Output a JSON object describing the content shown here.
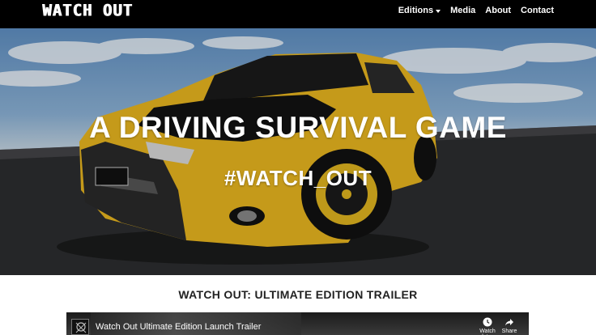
{
  "navbar": {
    "brand": "WATCH OUT",
    "links": [
      {
        "label": "Editions",
        "has_dropdown": true
      },
      {
        "label": "Media"
      },
      {
        "label": "About"
      },
      {
        "label": "Contact"
      }
    ]
  },
  "hero": {
    "title": "A DRIVING SURVIVAL GAME",
    "tagline": "#WATCH_OUT",
    "plate_text": "WATCH OUT"
  },
  "trailer": {
    "heading": "WATCH OUT: ULTIMATE EDITION TRAILER",
    "video_title": "Watch Out Ultimate Edition Launch Trailer",
    "actions": [
      {
        "label": "Watch later",
        "icon": "clock-icon"
      },
      {
        "label": "Share",
        "icon": "share-icon"
      }
    ]
  },
  "colors": {
    "navbar_bg": "#000000",
    "car_body": "#e8b51f",
    "car_hood": "#111111",
    "heading_text": "#222222"
  }
}
